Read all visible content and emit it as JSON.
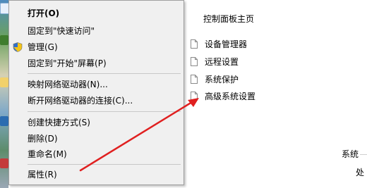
{
  "context_menu": {
    "open": "打开(O)",
    "pin_quick_access": "固定到\"快速访问\"",
    "manage": "管理(G)",
    "pin_start": "固定到\"开始\"屏幕(P)",
    "map_drive": "映射网络驱动器(N)...",
    "disconnect_drive": "断开网络驱动器的连接(C)...",
    "create_shortcut": "创建快捷方式(S)",
    "delete": "删除(D)",
    "rename": "重命名(M)",
    "properties": "属性(R)"
  },
  "system_window": {
    "control_panel_home": "控制面板主页",
    "links": [
      {
        "label": "设备管理器",
        "icon": "document-icon"
      },
      {
        "label": "远程设置",
        "icon": "document-icon"
      },
      {
        "label": "系统保护",
        "icon": "document-icon"
      },
      {
        "label": "高级系统设置",
        "icon": "document-icon"
      }
    ],
    "system_label": "系统",
    "processor_partial": "处"
  },
  "annotation": {
    "arrow_color": "#e02020"
  },
  "colors": {
    "menu_background": "#f0f0f0",
    "separator": "#c8c8c8"
  }
}
